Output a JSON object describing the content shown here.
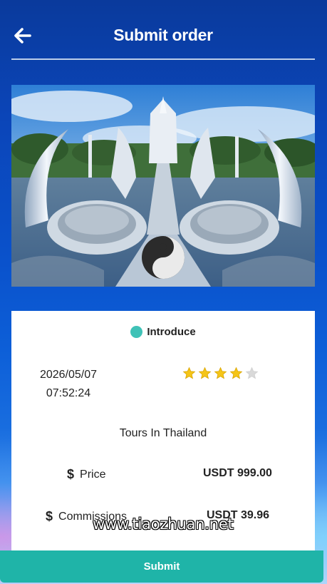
{
  "header": {
    "title": "Submit order"
  },
  "order": {
    "section_label": "Introduce",
    "date": "2026/05/07",
    "time": "07:52:24",
    "rating": 4,
    "rating_max": 5,
    "product_name": "Tours In Thailand",
    "price_label": "Price",
    "price_value": "USDT 999.00",
    "commission_label": "Commissions",
    "commission_value": "USDT 39.96"
  },
  "submit_label": "Submit",
  "watermark": "www.tiaozhuan.net",
  "colors": {
    "accent": "#1fb4a8",
    "intro_dot": "#3fc2b7",
    "star_filled": "#f5c518",
    "star_empty": "#d9d9d9"
  },
  "icons": {
    "back": "arrow-left-icon",
    "dollar": "dollar-icon",
    "star": "star-icon",
    "dot": "dot-icon"
  }
}
